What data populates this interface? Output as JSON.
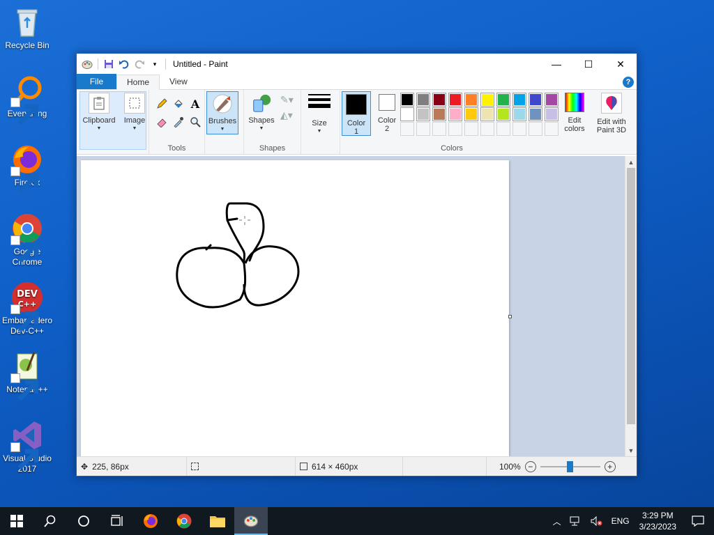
{
  "desktop": {
    "icons": [
      {
        "label": "Recycle Bin"
      },
      {
        "label": "Everything"
      },
      {
        "label": "Firefox"
      },
      {
        "label": "Google Chrome"
      },
      {
        "label": "Embarcadero Dev-C++"
      },
      {
        "label": "Notepad++"
      },
      {
        "label": "Visual Studio 2017"
      }
    ]
  },
  "window": {
    "title": "Untitled - Paint",
    "minimize": "—",
    "maximize": "☐",
    "close": "✕"
  },
  "tabs": {
    "file": "File",
    "home": "Home",
    "view": "View",
    "help": "?"
  },
  "ribbon": {
    "clipboard": "Clipboard",
    "image": "Image",
    "tools": "Tools",
    "brushes": "Brushes",
    "shapes": "Shapes",
    "shapes_group": "Shapes",
    "size": "Size",
    "color1": "Color 1",
    "color1_a": "Color",
    "color1_b": "1",
    "color2_a": "Color",
    "color2_b": "2",
    "edit_colors_a": "Edit",
    "edit_colors_b": "colors",
    "edit3d_a": "Edit with",
    "edit3d_b": "Paint 3D",
    "colors_group": "Colors"
  },
  "palette": {
    "row1": [
      "#000000",
      "#7f7f7f",
      "#880015",
      "#ed1c24",
      "#ff7f27",
      "#fff200",
      "#22b14c",
      "#00a2e8",
      "#3f48cc",
      "#a349a4"
    ],
    "row2": [
      "#ffffff",
      "#c3c3c3",
      "#b97a57",
      "#ffaec9",
      "#ffc90e",
      "#efe4b0",
      "#b5e61d",
      "#99d9ea",
      "#7092be",
      "#c8bfe7"
    ]
  },
  "status": {
    "cursor_pos": "225, 86px",
    "canvas_size": "614 × 460px",
    "zoom": "100%",
    "zoom_level": 0.5
  },
  "taskbar": {
    "time": "3:29 PM",
    "date": "3/23/2023",
    "lang": "ENG"
  }
}
